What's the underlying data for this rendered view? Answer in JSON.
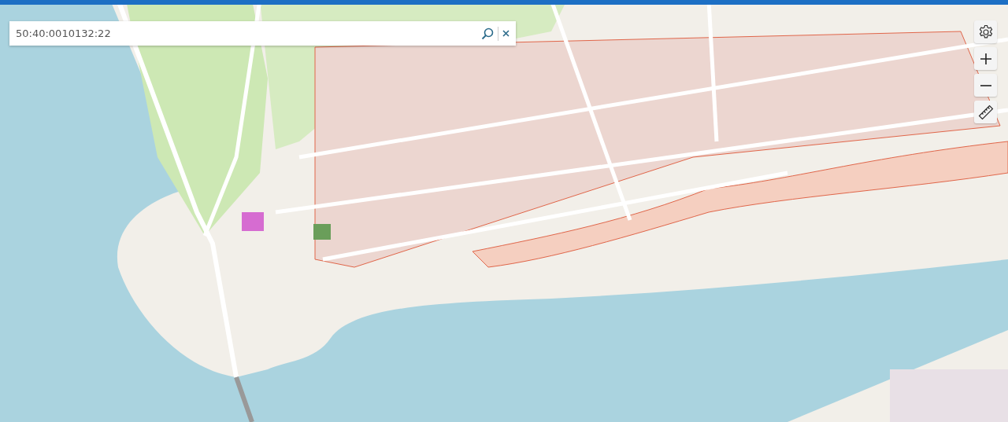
{
  "search": {
    "value": "50:40:0010132:22"
  }
}
